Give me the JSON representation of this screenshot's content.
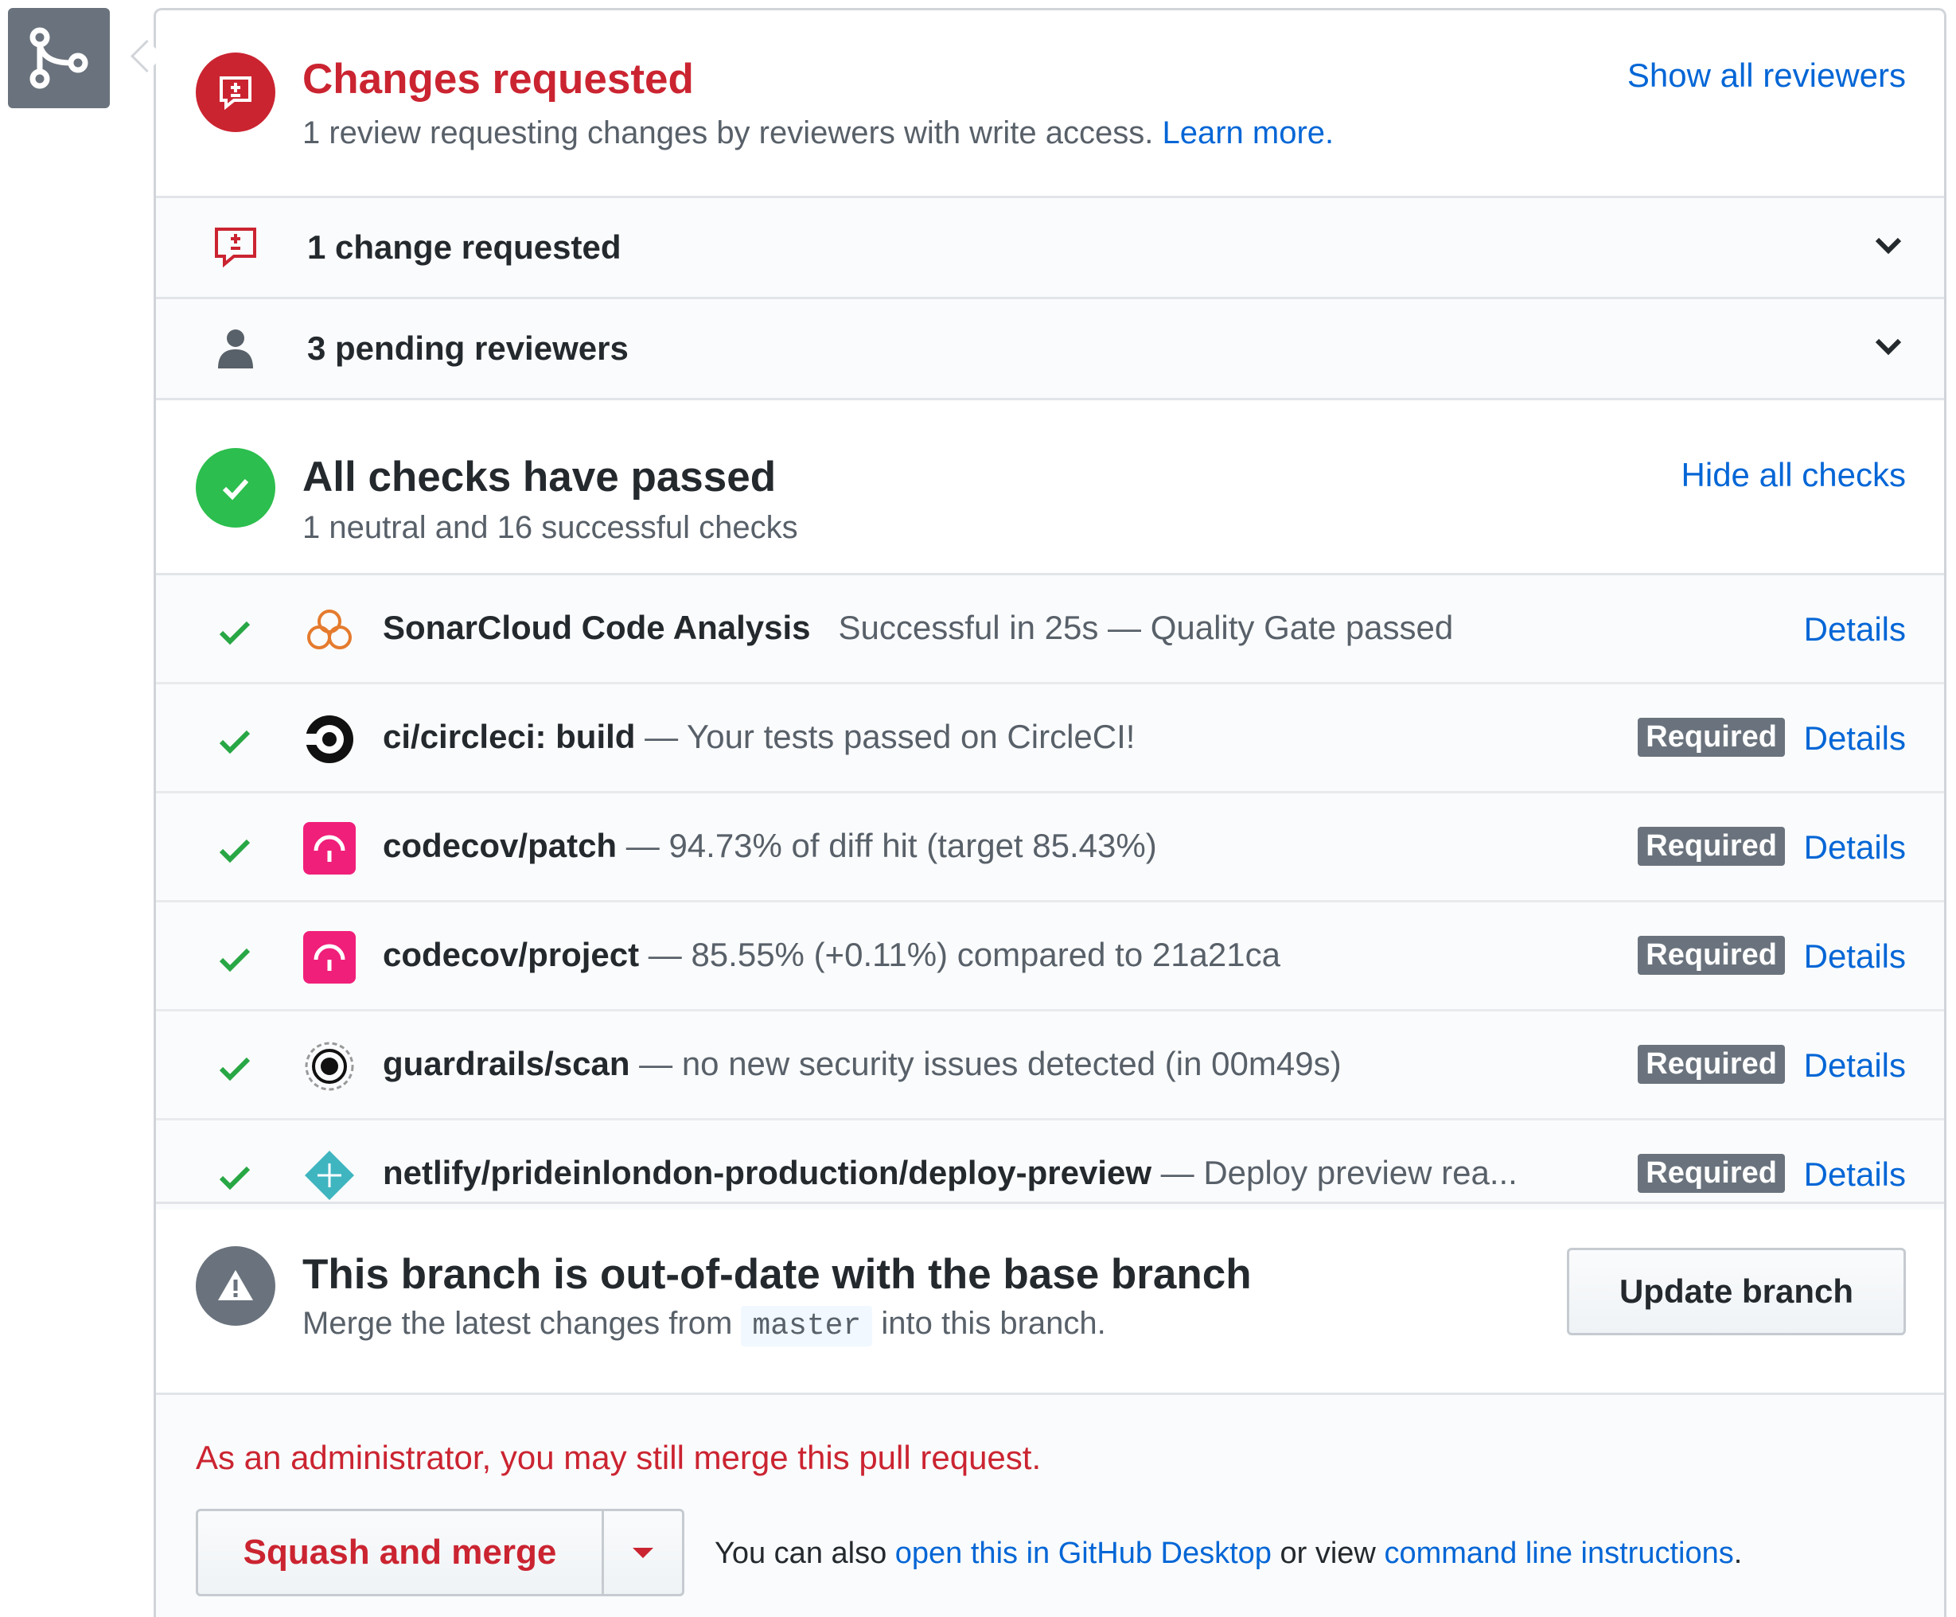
{
  "changes": {
    "title": "Changes requested",
    "desc": "1 review requesting changes by reviewers with write access.",
    "learn_more": "Learn more.",
    "show_all": "Show all reviewers"
  },
  "reviews": {
    "changes_requested": "1 change requested",
    "pending": "3 pending reviewers"
  },
  "checks": {
    "title": "All checks have passed",
    "subtitle": "1 neutral and 16 successful checks",
    "hide_all": "Hide all checks",
    "required_label": "Required",
    "details_label": "Details",
    "items": [
      {
        "name": "SonarCloud Code Analysis",
        "sep": "",
        "desc": "Successful in 25s — Quality Gate passed",
        "required": false
      },
      {
        "name": "ci/circleci: build",
        "sep": " — ",
        "desc": "Your tests passed on CircleCI!",
        "required": true
      },
      {
        "name": "codecov/patch",
        "sep": " — ",
        "desc": "94.73% of diff hit (target 85.43%)",
        "required": true
      },
      {
        "name": "codecov/project",
        "sep": " — ",
        "desc": "85.55% (+0.11%) compared to 21a21ca",
        "required": true
      },
      {
        "name": "guardrails/scan",
        "sep": " — ",
        "desc": "no new security issues detected (in 00m49s)",
        "required": true
      },
      {
        "name": "netlify/prideinlondon-production/deploy-preview",
        "sep": " — ",
        "desc": "Deploy preview rea...",
        "required": true
      }
    ]
  },
  "branch": {
    "title": "This branch is out-of-date with the base branch",
    "desc_before": "Merge the latest changes from",
    "base": "master",
    "desc_after": "into this branch.",
    "update_button": "Update branch"
  },
  "merge": {
    "admin_note": "As an administrator, you may still merge this pull request.",
    "button": "Squash and merge",
    "also_prefix": "You can also",
    "desktop_link": "open this in GitHub Desktop",
    "or_view": "or view",
    "cli_link": "command line instructions",
    "period": "."
  },
  "colors": {
    "danger": "#cb2431",
    "success": "#2cbe4e",
    "neutral": "#6a737d",
    "link": "#0366d6"
  }
}
